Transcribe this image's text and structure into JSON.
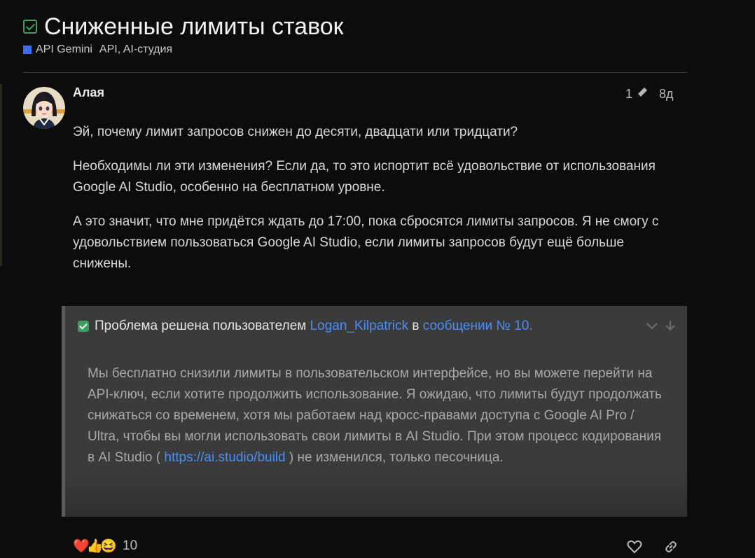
{
  "topic": {
    "title": "Сниженные лимиты ставок",
    "category": "API Gemini",
    "tags": "API, AI-студия",
    "category_color": "#3d6bf2"
  },
  "post": {
    "username": "Алая",
    "edit_count": "1",
    "age": "8д",
    "paragraphs": [
      "Эй, почему лимит запросов снижен до десяти, двадцати или тридцати?",
      "Необходимы ли эти изменения? Если да, то это испортит всё удовольствие от использования Google AI Studio, особенно на бесплатном уровне.",
      "А это значит, что мне придётся ждать до 17:00, пока сбросятся лимиты запросов. Я не смогу с удовольствием пользоваться Google AI Studio, если лимиты запросов будут ещё больше снижены."
    ]
  },
  "solution": {
    "prefix": "Проблема решена пользователем",
    "author": "Logan_Kilpatrick",
    "in": "в",
    "post_ref": "сообщении № 10.",
    "text_before_link": "Мы бесплатно снизили лимиты в пользовательском интерфейсе, но вы можете перейти на API-ключ, если хотите продолжить использование. Я ожидаю, что лимиты будут продолжать снижаться со временем, хотя мы работаем над кросс-правами доступа с Google AI Pro / Ultra, чтобы вы могли использовать свои лимиты в AI Studio. При этом процесс кодирования в AI Studio (",
    "link": "https://ai.studio/build",
    "text_after_link": ") не изменился, только песочница.",
    "accent_color": "#4a8ef5"
  },
  "actions": {
    "reaction_count": "10",
    "reactions": [
      "❤️",
      "👍",
      "😆"
    ],
    "icons": [
      "heart-icon",
      "link-icon"
    ]
  }
}
